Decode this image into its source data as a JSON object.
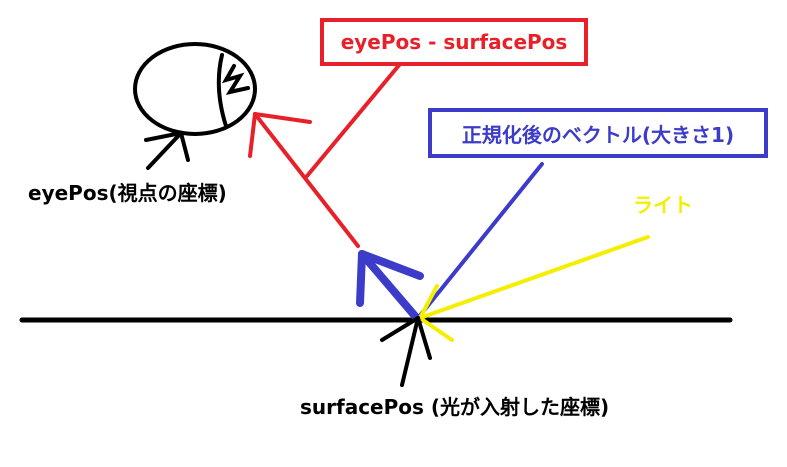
{
  "labels": {
    "eye_pos": "eyePos(視点の座標)",
    "surface_pos": "surfacePos (光が入射した座標)",
    "diff_vector": "eyePos - surfacePos",
    "normalized_vector": "正規化後のベクトル(大きさ1)",
    "light": "ライト"
  },
  "colors": {
    "ink": "#000000",
    "red": "#e8202a",
    "blue": "#3c3cc8",
    "yellow": "#f5ee00"
  }
}
